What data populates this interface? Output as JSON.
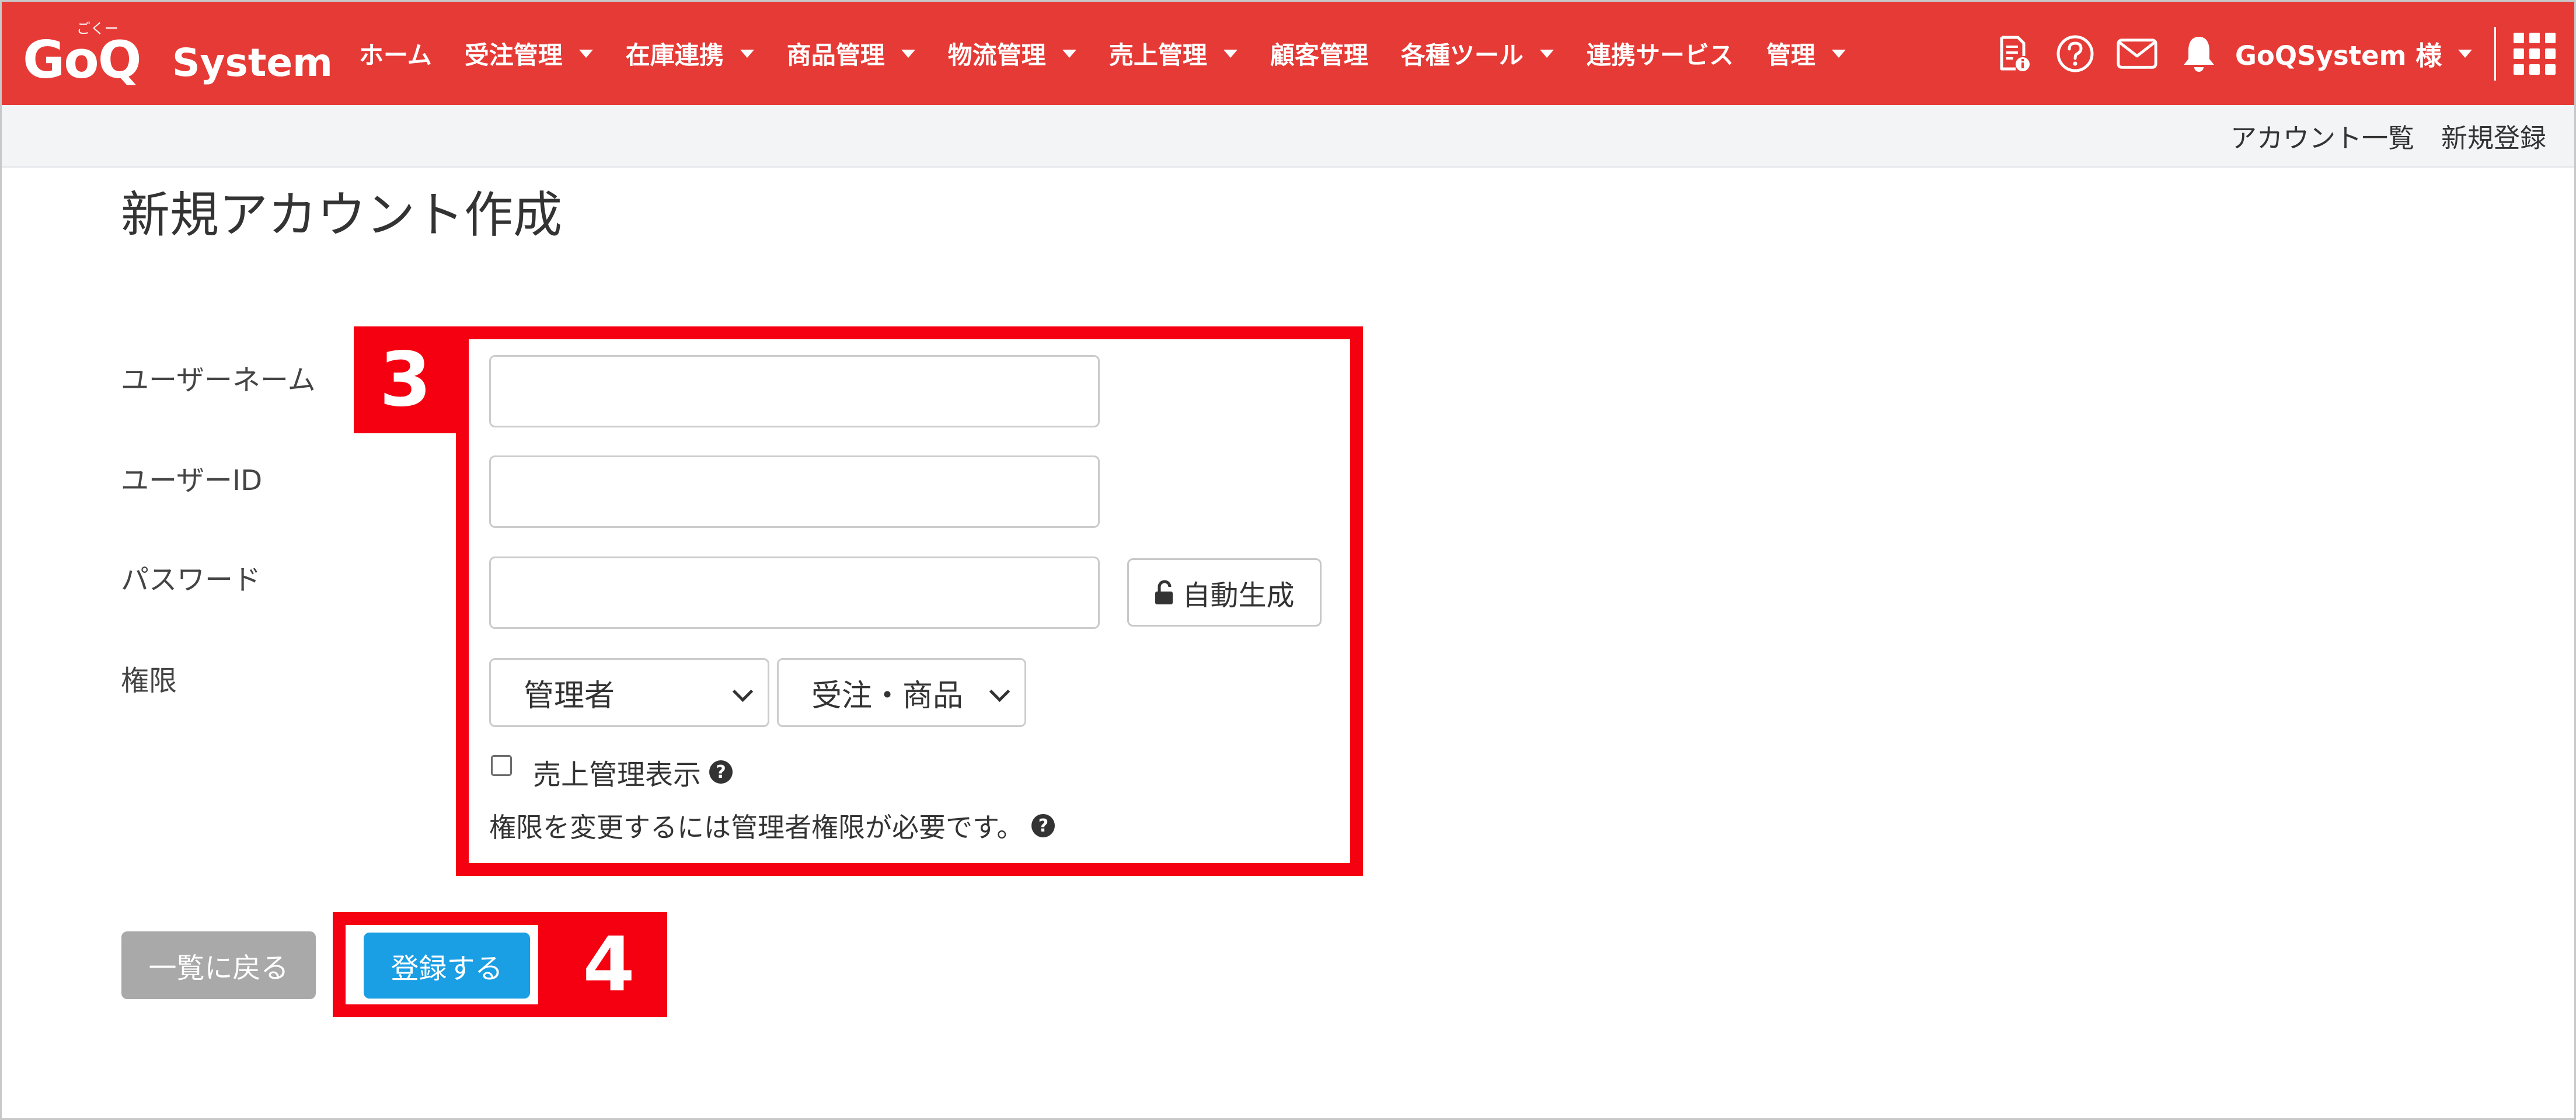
{
  "navbar": {
    "logo": {
      "main": "GoQ",
      "suffix": "System",
      "ruby": "ごくー"
    },
    "menu": [
      {
        "label": "ホーム",
        "dropdown": false
      },
      {
        "label": "受注管理",
        "dropdown": true
      },
      {
        "label": "在庫連携",
        "dropdown": true
      },
      {
        "label": "商品管理",
        "dropdown": true
      },
      {
        "label": "物流管理",
        "dropdown": true
      },
      {
        "label": "売上管理",
        "dropdown": true
      },
      {
        "label": "顧客管理",
        "dropdown": false
      },
      {
        "label": "各種ツール",
        "dropdown": true
      },
      {
        "label": "連携サービス",
        "dropdown": false
      },
      {
        "label": "管理",
        "dropdown": true
      }
    ],
    "icons": [
      "report-icon",
      "help-circle-icon",
      "mail-icon",
      "bell-icon"
    ],
    "user_label": "GoQSystem 様",
    "apps_icon": "apps-grid-icon"
  },
  "subnav": {
    "account_list": "アカウント一覧",
    "new_register": "新規登録"
  },
  "page_title": "新規アカウント作成",
  "form": {
    "username_label": "ユーザーネーム",
    "userid_label": "ユーザーID",
    "password_label": "パスワード",
    "permission_label": "権限",
    "username_value": "",
    "userid_value": "",
    "password_value": "",
    "generate_button": "自動生成",
    "role_select": "管理者",
    "scope_select": "受注・商品",
    "sales_display_label": "売上管理表示",
    "sales_display_checked": false,
    "permission_note": "権限を変更するには管理者権限が必要です。"
  },
  "buttons": {
    "back": "一覧に戻る",
    "submit": "登録する"
  },
  "annotations": [
    {
      "label": "3"
    },
    {
      "label": "4"
    }
  ],
  "colors": {
    "brand_red": "#e63a36",
    "highlight_red": "#f50010",
    "submit_blue": "#1a9ee4",
    "back_gray": "#a9a9a9"
  }
}
